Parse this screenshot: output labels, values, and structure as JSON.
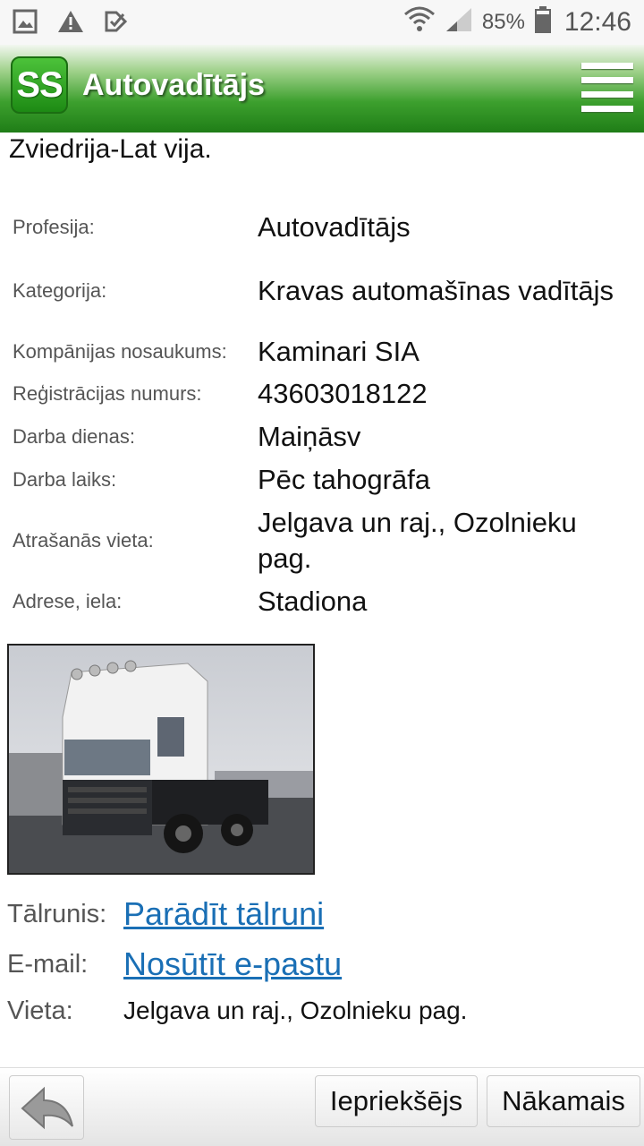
{
  "status_bar": {
    "battery": "85%",
    "time": "12:46"
  },
  "app_bar": {
    "logo_text": "SS",
    "title": "Autovadītājs"
  },
  "heading": "Zviedrija-Lat vija.",
  "details": [
    {
      "label": "Profesija:",
      "value": "Autovadītājs"
    },
    {
      "label": "Kategorija:",
      "value": "Kravas automašīnas vadītājs"
    },
    {
      "label": "Kompānijas nosaukums:",
      "value": "Kaminari SIA"
    },
    {
      "label": "Reģistrācijas numurs:",
      "value": "43603018122"
    },
    {
      "label": "Darba dienas:",
      "value": "Maiņāsv"
    },
    {
      "label": "Darba laiks:",
      "value": "Pēc tahogrāfa"
    },
    {
      "label": "Atrašanās vieta:",
      "value": "Jelgava un raj., Ozolnieku pag."
    },
    {
      "label": "Adrese, iela:",
      "value": "Stadiona"
    }
  ],
  "contact": {
    "phone_label": "Tālrunis:",
    "phone_link": "Parādīt tālruni",
    "email_label": "E-mail:",
    "email_link": "Nosūtīt e-pastu",
    "place_label": "Vieta:",
    "place_value": "Jelgava un raj., Ozolnieku pag."
  },
  "bottom_bar": {
    "prev_label": "Iepriekšējs",
    "next_label": "Nākamais"
  },
  "colors": {
    "brand_green": "#2e9a22",
    "link_blue": "#1a6fb5"
  }
}
